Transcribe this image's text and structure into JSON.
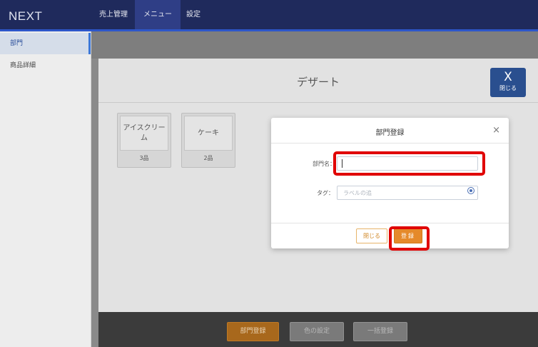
{
  "app": {
    "brand": "NEXT"
  },
  "nav": {
    "items": [
      {
        "label": "売上管理"
      },
      {
        "label": "メニュー"
      },
      {
        "label": "設定"
      }
    ]
  },
  "sidebar": {
    "items": [
      {
        "label": "部門"
      },
      {
        "label": "商品詳細"
      }
    ]
  },
  "panel": {
    "title": "デザート",
    "close": {
      "symbol": "X",
      "label": "閉じる"
    },
    "tiles": [
      {
        "name": "アイスクリーム",
        "count": "3品"
      },
      {
        "name": "ケーキ",
        "count": "2品"
      }
    ]
  },
  "bottombar": {
    "register_label": "部門登録",
    "color_label": "色の設定",
    "bulk_label": "一括登録"
  },
  "modal": {
    "title": "部門登録",
    "close_symbol": "×",
    "name_label": "部門名：",
    "name_value": "",
    "tag_label": "タグ：",
    "tag_placeholder": "ラベルの追",
    "cancel_label": "閉じる",
    "submit_label": "登録"
  },
  "colors": {
    "navbar": "#1f2a5c",
    "nav_active": "#2f3e86",
    "accent": "#e5892a",
    "highlight": "#e00000"
  }
}
